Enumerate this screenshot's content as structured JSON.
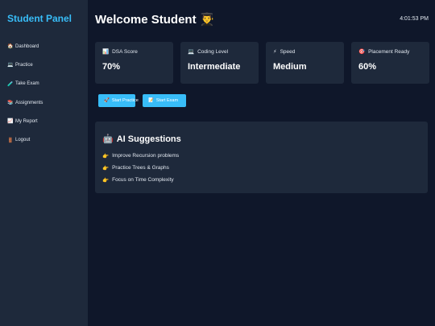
{
  "sidebar": {
    "brand": "Student Panel",
    "items": [
      {
        "icon": "🏠",
        "label": "Dashboard"
      },
      {
        "icon": "💻",
        "label": "Practice"
      },
      {
        "icon": "🧪",
        "label": "Take Exam"
      },
      {
        "icon": "📚",
        "label": "Assignments"
      },
      {
        "icon": "📈",
        "label": "My Report"
      },
      {
        "icon": "🚪",
        "label": "Logout"
      }
    ]
  },
  "header": {
    "title": "Welcome Student 👨‍🎓",
    "clock": "4:01:53 PM"
  },
  "cards": [
    {
      "icon": "📊",
      "label": "DSA Score",
      "value": "70%"
    },
    {
      "icon": "💻",
      "label": "Coding Level",
      "value": "Intermediate"
    },
    {
      "icon": "⚡",
      "label": "Speed",
      "value": "Medium"
    },
    {
      "icon": "🎯",
      "label": "Placement Ready",
      "value": "60%"
    }
  ],
  "actions": {
    "practice": {
      "icon": "🚀",
      "label": "Start Practice"
    },
    "exam": {
      "icon": "📝",
      "label": "Start Exam"
    }
  },
  "ai": {
    "icon": "🤖",
    "title": "AI Suggestions",
    "point_icon": "👉",
    "suggestions": [
      "Improve Recursion problems",
      "Practice Trees & Graphs",
      "Focus on Time Complexity"
    ]
  },
  "colors": {
    "background": "#0f172a",
    "panel": "#1e293b",
    "accent": "#38bdf8"
  }
}
